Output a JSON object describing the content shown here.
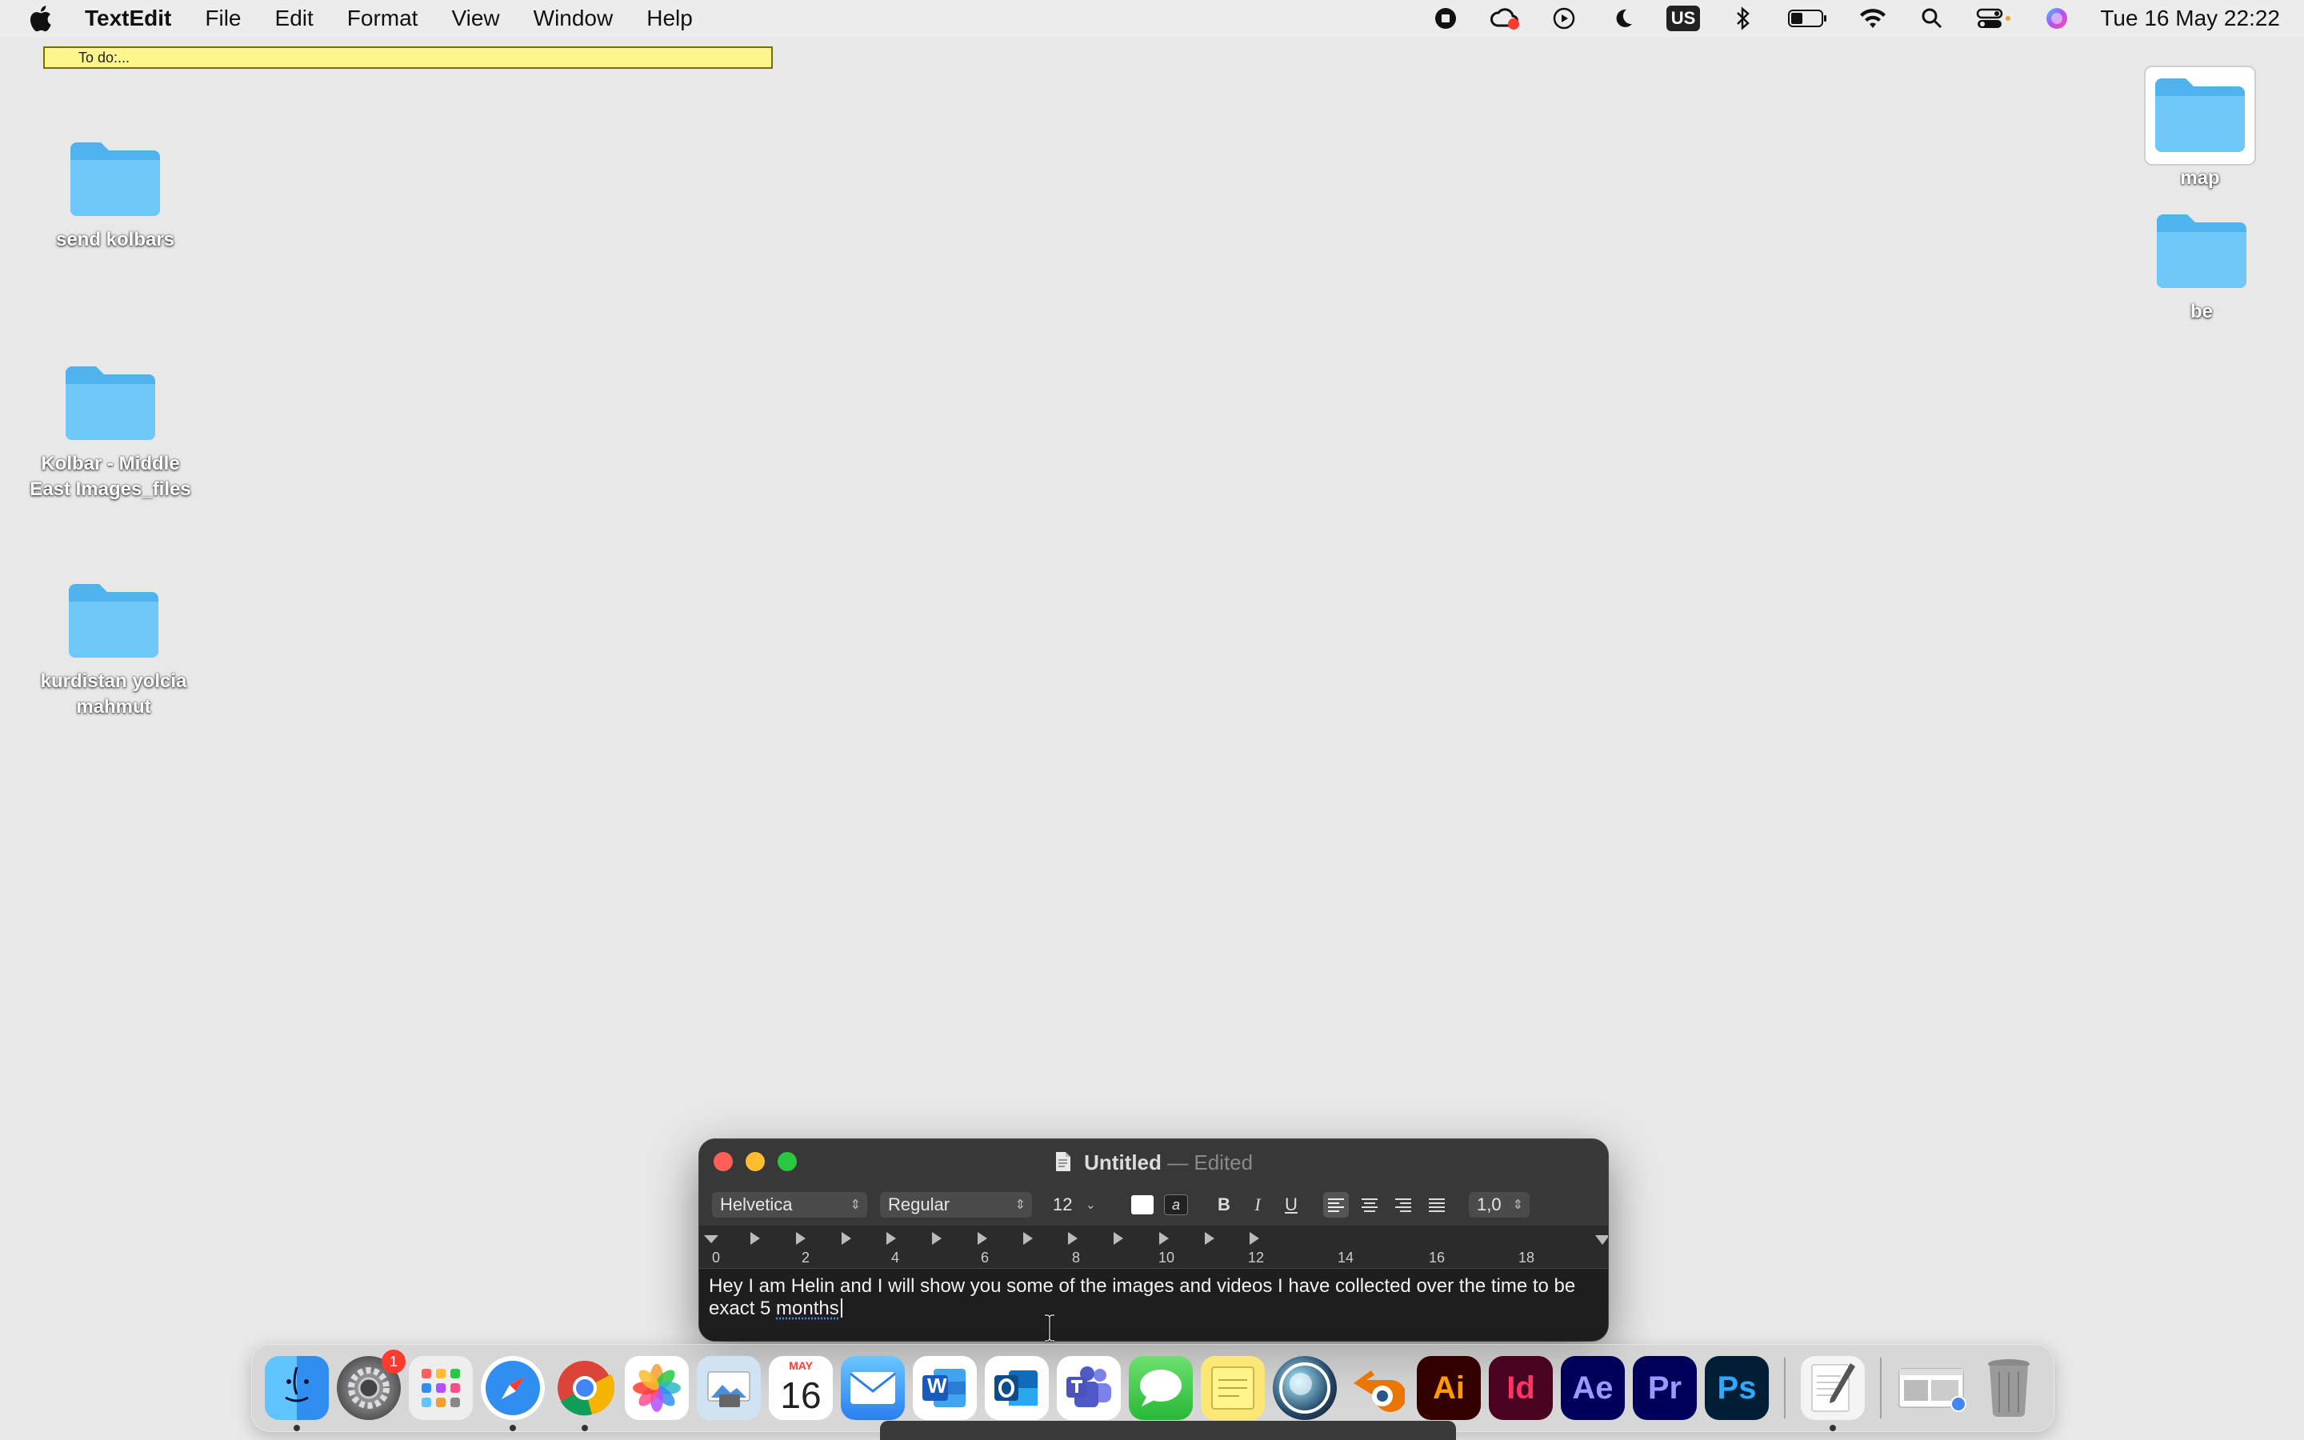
{
  "menubar": {
    "app_name": "TextEdit",
    "menus": [
      "File",
      "Edit",
      "Format",
      "View",
      "Window",
      "Help"
    ],
    "input_source": "US",
    "clock": "Tue 16 May  22:22"
  },
  "sticky_note": {
    "text": "To do:..."
  },
  "desktop": {
    "icons": [
      {
        "label": "send kolbars"
      },
      {
        "label": "Kolbar - Middle East Images_files"
      },
      {
        "label": "kurdistan yolcia mahmut"
      },
      {
        "label": "map"
      },
      {
        "label": "be"
      }
    ]
  },
  "window": {
    "title": "Untitled",
    "separator": "—",
    "status": "Edited",
    "toolbar": {
      "font_family": "Helvetica",
      "font_style": "Regular",
      "font_size": "12",
      "bold": "B",
      "italic": "I",
      "underline": "U",
      "line_spacing": "1,0",
      "highlight_glyph": "a"
    },
    "ruler_labels": [
      "0",
      "2",
      "4",
      "6",
      "8",
      "10",
      "12",
      "14",
      "16",
      "18"
    ],
    "document": {
      "line1": "Hey I am Helin and I will show you some of the images and videos I have collected over the time  to be",
      "line2_prefix": "exact 5 ",
      "line2_misspelled": "months"
    }
  },
  "dock": {
    "calendar_month": "MAY",
    "calendar_day": "16",
    "settings_badge": "1",
    "adobe": {
      "ai": "Ai",
      "id": "Id",
      "ae": "Ae",
      "pr": "Pr",
      "ps": "Ps"
    },
    "word_glyph": "W"
  }
}
